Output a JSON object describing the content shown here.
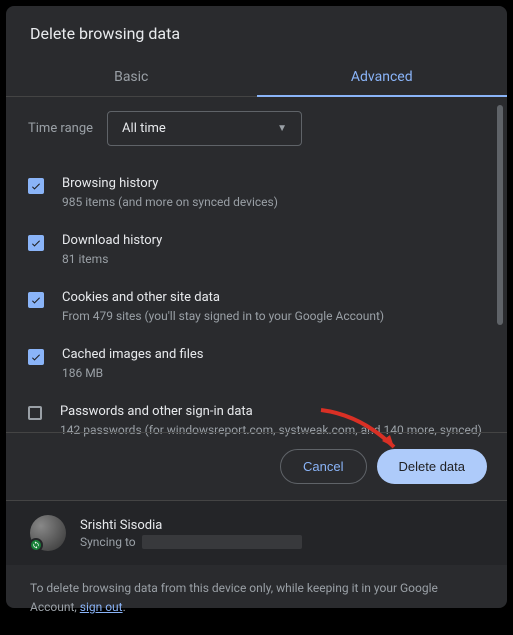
{
  "title": "Delete browsing data",
  "tabs": {
    "basic": "Basic",
    "advanced": "Advanced"
  },
  "range": {
    "label": "Time range",
    "value": "All time"
  },
  "items": [
    {
      "title": "Browsing history",
      "sub": "985 items (and more on synced devices)",
      "checked": true
    },
    {
      "title": "Download history",
      "sub": "81 items",
      "checked": true
    },
    {
      "title": "Cookies and other site data",
      "sub": "From 479 sites (you'll stay signed in to your Google Account)",
      "checked": true
    },
    {
      "title": "Cached images and files",
      "sub": "186 MB",
      "checked": true
    },
    {
      "title": "Passwords and other sign-in data",
      "sub": "142 passwords (for windowsreport.com, systweak.com, and 140 more, synced)",
      "checked": false
    }
  ],
  "buttons": {
    "cancel": "Cancel",
    "confirm": "Delete data"
  },
  "user": {
    "name": "Srishti Sisodia",
    "sync_prefix": "Syncing to"
  },
  "note": {
    "text": "To delete browsing data from this device only, while keeping it in your Google Account, ",
    "link": "sign out",
    "suffix": "."
  }
}
